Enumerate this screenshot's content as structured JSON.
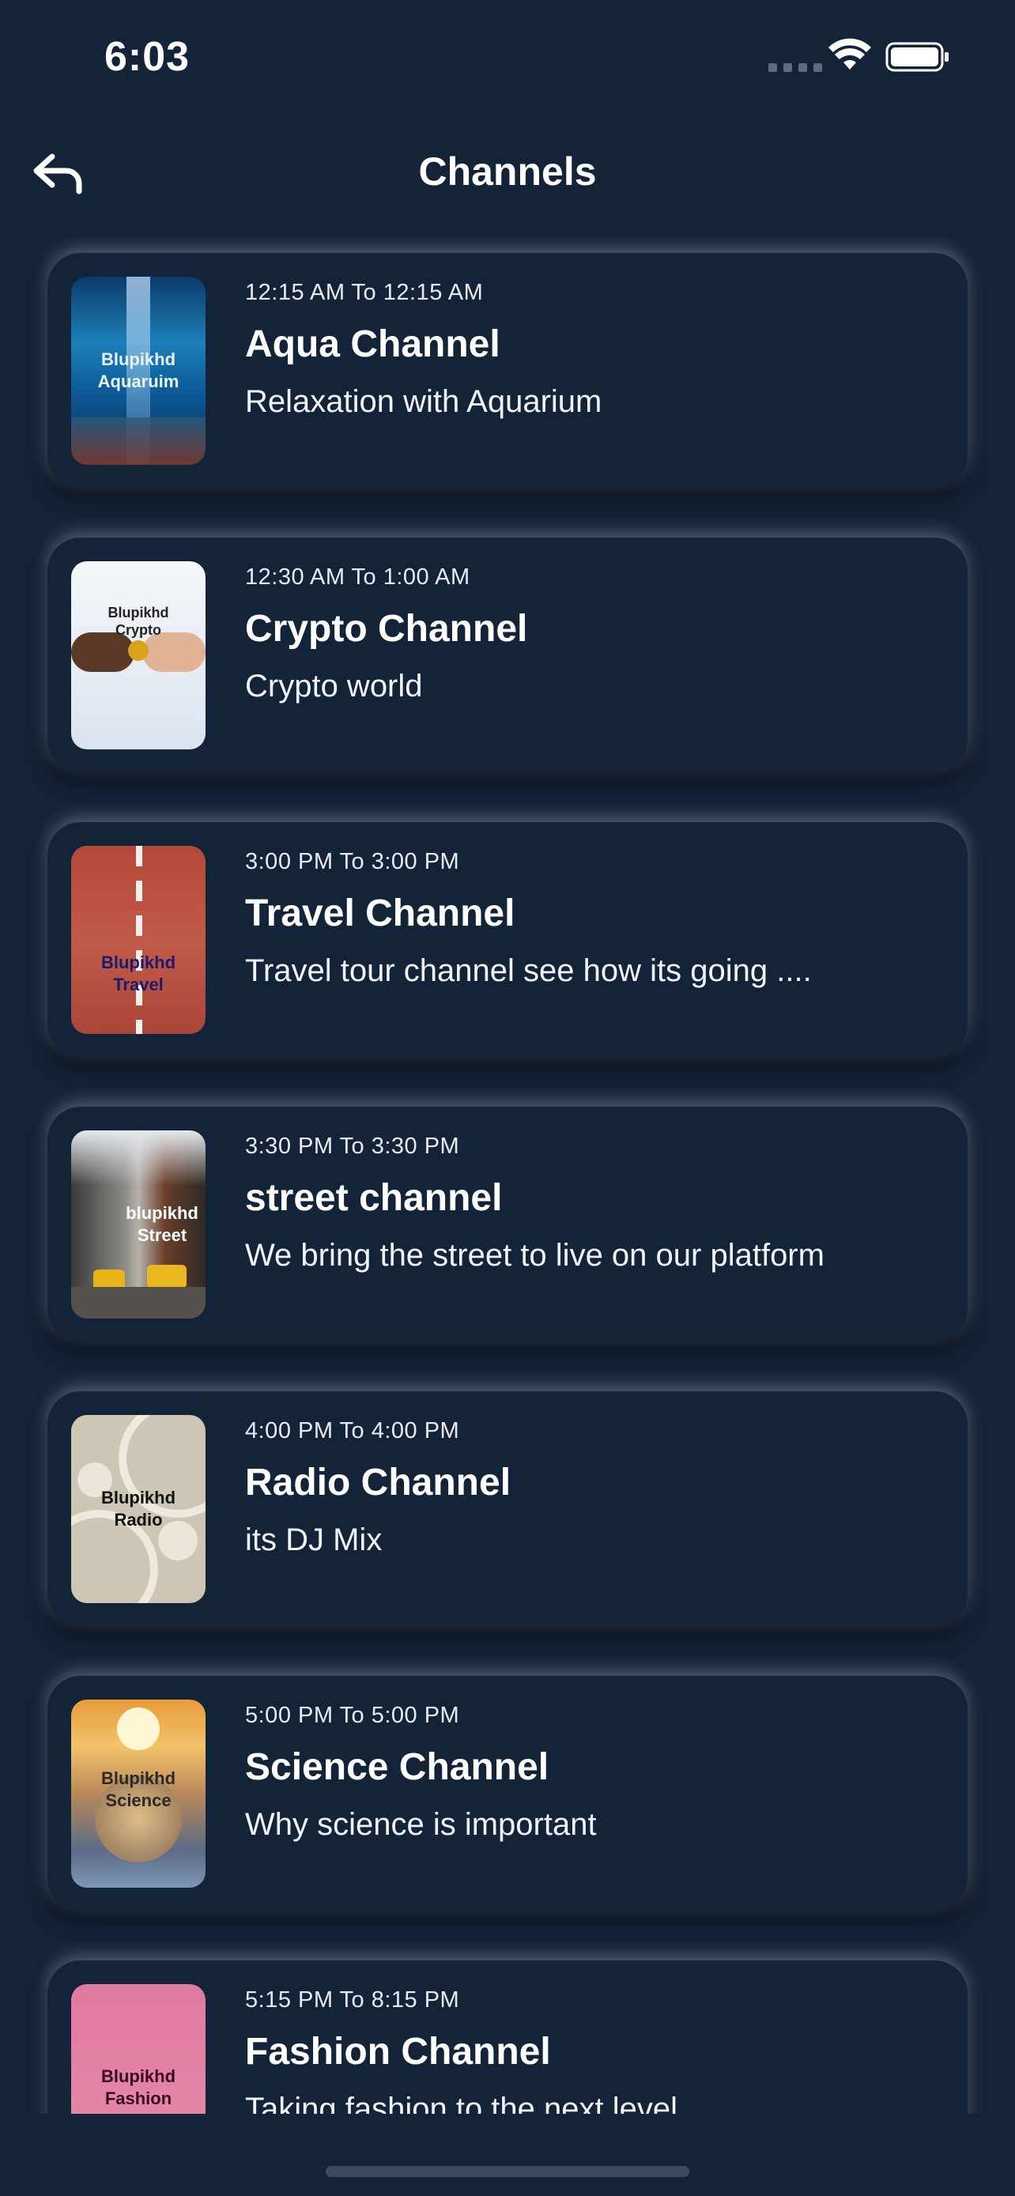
{
  "status_bar": {
    "time": "6:03"
  },
  "header": {
    "title": "Channels",
    "back_icon": "back-arrow-icon"
  },
  "channels": [
    {
      "time": "12:15 AM To 12:15 AM",
      "title": "Aqua Channel",
      "description": "Relaxation with Aquarium",
      "thumb_text": "Blupikhd\nAquaruim"
    },
    {
      "time": "12:30 AM To 1:00 AM",
      "title": "Crypto Channel",
      "description": "Crypto world",
      "thumb_text": "Blupikhd\nCrypto"
    },
    {
      "time": "3:00 PM To 3:00 PM",
      "title": "Travel Channel",
      "description": "Travel tour channel see how its going ....",
      "thumb_text": "Blupikhd\nTravel"
    },
    {
      "time": "3:30 PM To 3:30 PM",
      "title": "street channel",
      "description": "We bring the street to live on our platform",
      "thumb_text": "blupikhd\nStreet"
    },
    {
      "time": "4:00 PM To 4:00 PM",
      "title": "Radio Channel",
      "description": "its DJ Mix",
      "thumb_text": "Blupikhd\nRadio"
    },
    {
      "time": "5:00 PM To 5:00 PM",
      "title": "Science Channel",
      "description": "Why science is important",
      "thumb_text": "Blupikhd\nScience"
    },
    {
      "time": "5:15 PM To 8:15 PM",
      "title": "Fashion Channel",
      "description": "Taking fashion to the next level",
      "thumb_text": "Blupikhd\nFashion"
    }
  ],
  "colors": {
    "background": "#132439",
    "text": "#ffffff"
  }
}
